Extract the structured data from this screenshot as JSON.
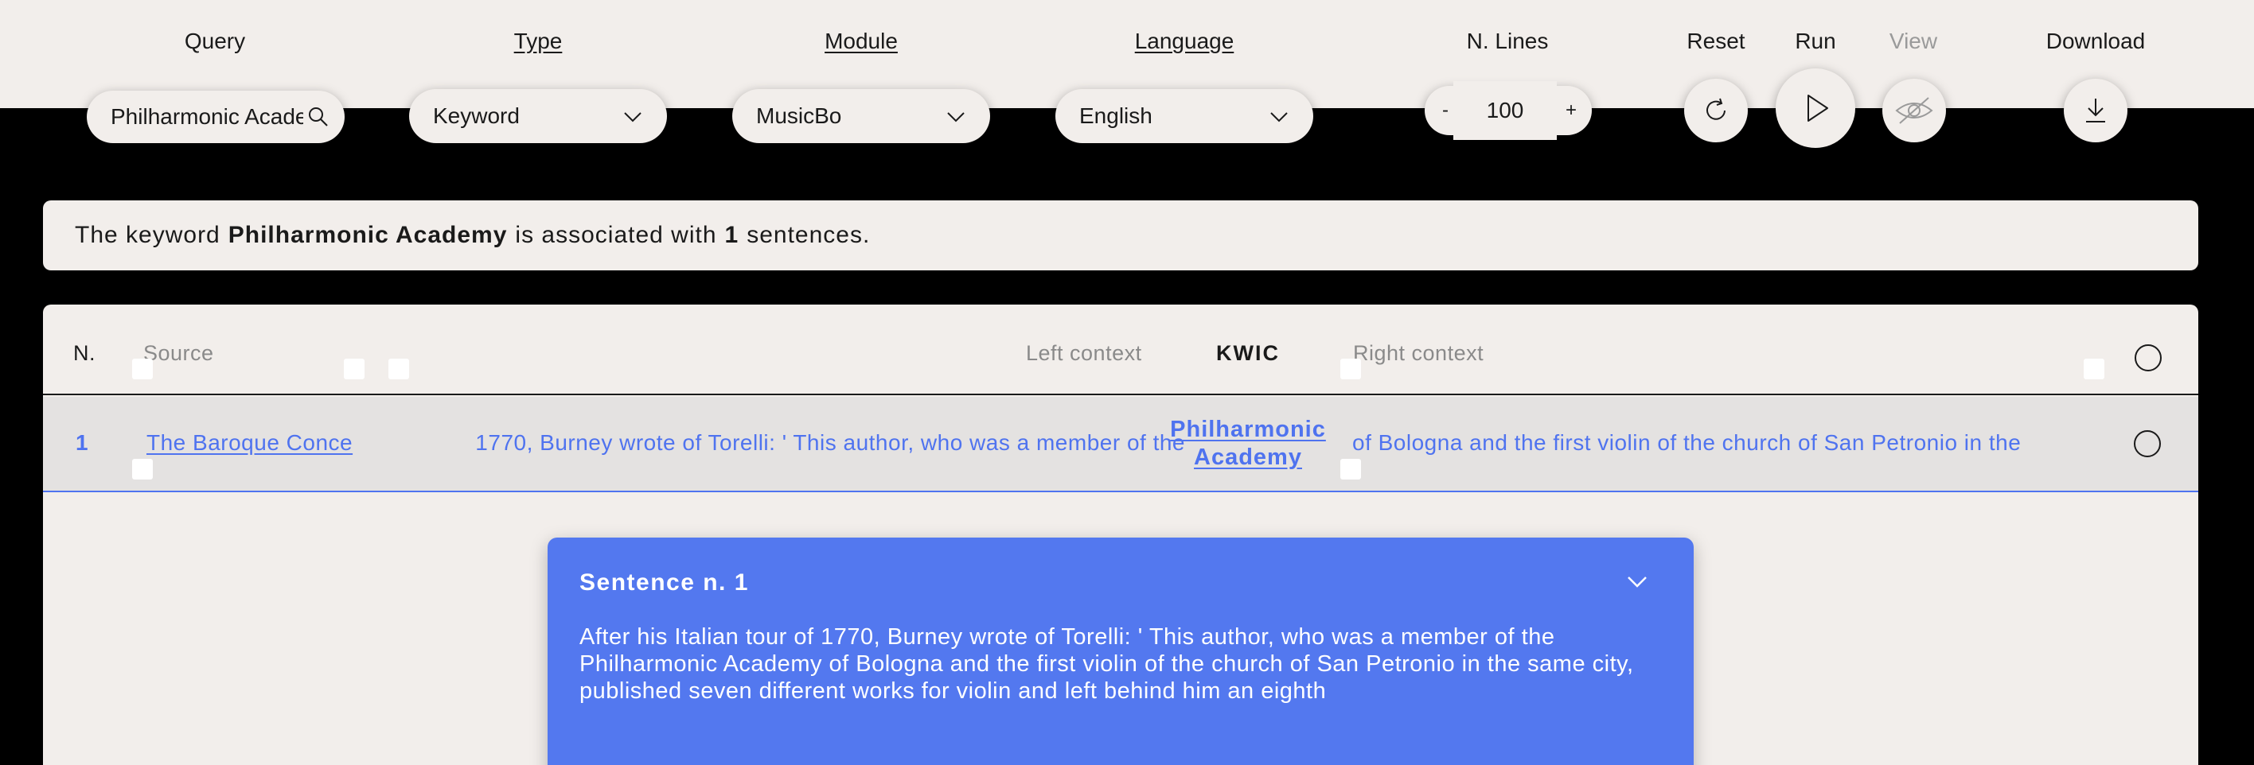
{
  "toolbar": {
    "query_label": "Query",
    "type_label": "Type",
    "module_label": "Module",
    "language_label": "Language",
    "lines_label": "N. Lines",
    "reset_label": "Reset",
    "run_label": "Run",
    "view_label": "View",
    "download_label": "Download",
    "query_value": "Philharmonic Academy",
    "type_value": "Keyword",
    "module_value": "MusicBo",
    "language_value": "English",
    "lines_value": "100",
    "minus": "-",
    "plus": "+"
  },
  "info": {
    "prefix": "The keyword",
    "keyword": "Philharmonic Academy",
    "middle": "is associated with",
    "count": "1",
    "suffix": "sentences."
  },
  "table": {
    "headers": {
      "n": "N.",
      "source": "Source",
      "left": "Left context",
      "kwic": "KWIC",
      "right": "Right context"
    },
    "rows": [
      {
        "n": "1",
        "source": "The Baroque Conce",
        "left": "1770, Burney wrote of Torelli: ' This author, who was a member of the",
        "kwic": "Philharmonic Academy",
        "right": "of Bologna and the first violin of the church of San Petronio in the"
      }
    ]
  },
  "sentence": {
    "title": "Sentence n. 1",
    "text": "After his Italian tour of 1770, Burney wrote of Torelli: ' This author, who was a member of the Philharmonic Academy of Bologna and the first violin of the church of San Petronio in the same city, published seven different works for violin and left behind him an eighth"
  },
  "colors": {
    "accent": "#4f73ef",
    "card": "#5378ef",
    "surface": "#f2eeeb",
    "background": "#000000"
  },
  "icons": [
    "search-icon",
    "chevron-down-icon",
    "reset-icon",
    "play-icon",
    "eye-off-icon",
    "download-icon"
  ]
}
